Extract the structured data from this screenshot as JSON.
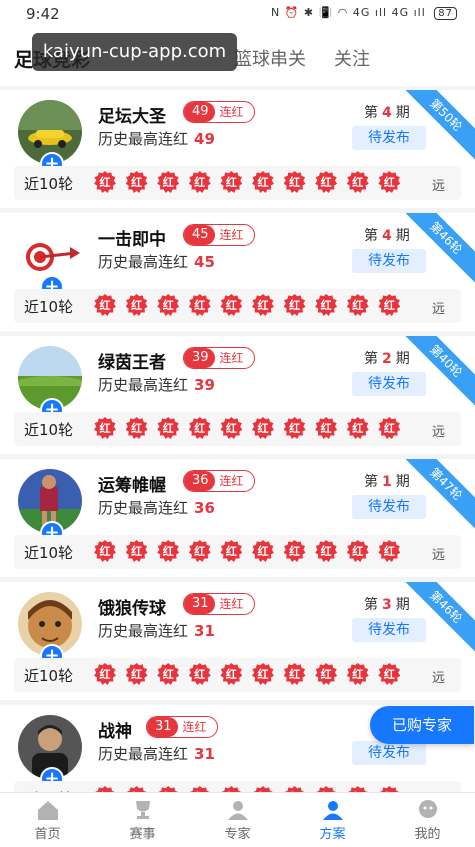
{
  "status": {
    "time": "9:42",
    "icons": "N ⏰ ✱ 📳 ◠ 4G ıll 4G ıll",
    "battery": "87"
  },
  "tabs": [
    {
      "label": "足球竞彩",
      "active": true
    },
    {
      "label": "篮球串关",
      "active": false
    },
    {
      "label": "关注",
      "active": false
    }
  ],
  "watermark": "kaiyun-cup-app.com",
  "labels": {
    "streak": "连红",
    "history": "历史最高连红",
    "period_prefix": "第",
    "period_suffix": "期",
    "pending": "待发布",
    "recent": "近10轮",
    "more": "远",
    "badge": "红"
  },
  "experts": [
    {
      "name": "足坛大圣",
      "streak": "49",
      "best": "49",
      "period": "4",
      "round": "第50轮",
      "avatar": "car-avatar"
    },
    {
      "name": "一击即中",
      "streak": "45",
      "best": "45",
      "period": "4",
      "round": "第46轮",
      "avatar": "target-avatar"
    },
    {
      "name": "绿茵王者",
      "streak": "39",
      "best": "39",
      "period": "2",
      "round": "第40轮",
      "avatar": "field-avatar"
    },
    {
      "name": "运筹帷幄",
      "streak": "36",
      "best": "36",
      "period": "1",
      "round": "第47轮",
      "avatar": "player-avatar"
    },
    {
      "name": "饿狼传球",
      "streak": "31",
      "best": "31",
      "period": "3",
      "round": "第46轮",
      "avatar": "face-avatar"
    },
    {
      "name": "战神",
      "streak": "31",
      "best": "31",
      "period": "",
      "round": "",
      "avatar": "man-avatar"
    }
  ],
  "float_button": "已购专家",
  "bottom_nav": [
    {
      "label": "首页",
      "icon": "home-icon",
      "active": false
    },
    {
      "label": "赛事",
      "icon": "trophy-icon",
      "active": false
    },
    {
      "label": "专家",
      "icon": "expert-icon",
      "active": false
    },
    {
      "label": "方案",
      "icon": "plan-icon",
      "active": true
    },
    {
      "label": "我的",
      "icon": "profile-icon",
      "active": false
    }
  ],
  "colors": {
    "accent": "#1677ff",
    "red": "#e6373f",
    "ribbon": "#3aa0f5"
  }
}
